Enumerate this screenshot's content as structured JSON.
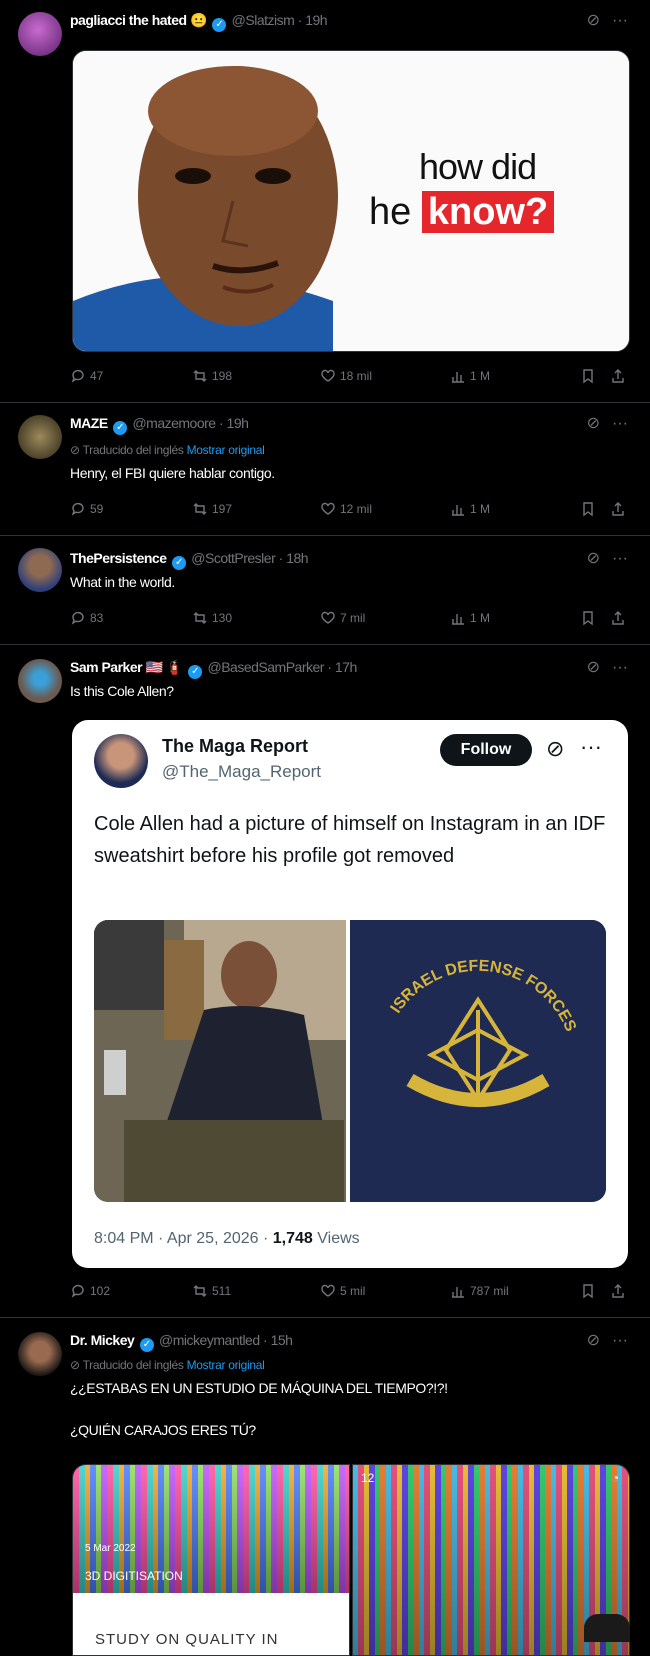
{
  "posts": [
    {
      "name": "pagliacci the hated",
      "handle": "@Slatzism",
      "time": "· 19h",
      "meme": {
        "line1": "how did",
        "line2a": "he",
        "line2b": "know?"
      },
      "stats": {
        "replies": "47",
        "reposts": "198",
        "likes": "18 mil",
        "views": "1 M"
      }
    },
    {
      "name": "MAZE",
      "handle": "@mazemoore",
      "time": "· 19h",
      "translated": "Traducido del inglés",
      "show_original": "Mostrar original",
      "text": "Henry, el FBI quiere hablar contigo.",
      "stats": {
        "replies": "59",
        "reposts": "197",
        "likes": "12 mil",
        "views": "1 M"
      }
    },
    {
      "name": "ThePersistence",
      "handle": "@ScottPresler",
      "time": "· 18h",
      "text": "What in the world.",
      "stats": {
        "replies": "83",
        "reposts": "130",
        "likes": "7 mil",
        "views": "1 M"
      }
    },
    {
      "name": "Sam Parker",
      "name_emoji": "🇺🇸 🧯",
      "handle": "@BasedSamParker",
      "time": "· 17h",
      "text": "Is this Cole Allen?",
      "quote": {
        "name": "The Maga Report",
        "handle": "@The_Maga_Report",
        "follow": "Follow",
        "text": "Cole Allen had a picture of himself on Instagram in an IDF sweatshirt before his profile got removed",
        "time": "8:04 PM · Apr 25, 2026 · ",
        "views_count": "1,748",
        "views_label": " Views",
        "emblem_top": "ISRAEL DEFENSE FORCES"
      },
      "stats": {
        "replies": "102",
        "reposts": "511",
        "likes": "5 mil",
        "views": "787 mil"
      }
    },
    {
      "name": "Dr. Mickey",
      "handle": "@mickeymantled",
      "time": "· 15h",
      "translated": "Traducido del inglés",
      "show_original": "Mostrar original",
      "text1": "¿¿ESTABAS EN UN ESTUDIO DE MÁQUINA DEL TIEMPO?!?!",
      "text2": "¿QUIÉN CARAJOS ERES TÚ?",
      "img_left_date": "5 Mar 2022",
      "img_left_caption": "3D DIGITISATION",
      "img_left_bottom": "STUDY ON QUALITY IN",
      "img_right_num": "12"
    }
  ],
  "colors": {
    "accent": "#1d9bf0",
    "bg": "#000000",
    "muted": "#71767b",
    "meme_red": "#e5262b"
  }
}
